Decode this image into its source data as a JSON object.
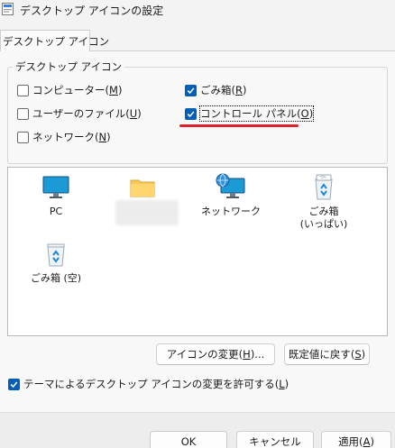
{
  "window": {
    "title": "デスクトップ アイコンの設定"
  },
  "tabs": [
    {
      "label": "デスクトップ アイコン"
    }
  ],
  "group": {
    "legend": "デスクトップ アイコン",
    "checkboxes": [
      {
        "label": "コンピューター(",
        "key": "M",
        "tail": ")",
        "checked": false
      },
      {
        "label": "ユーザーのファイル(",
        "key": "U",
        "tail": ")",
        "checked": false
      },
      {
        "label": "ネットワーク(",
        "key": "N",
        "tail": ")",
        "checked": false
      },
      {
        "label": "ごみ箱(",
        "key": "R",
        "tail": ")",
        "checked": true
      },
      {
        "label": "コントロール パネル(",
        "key": "O",
        "tail": ")",
        "checked": true
      }
    ]
  },
  "icons": [
    {
      "label": "PC",
      "icon": "monitor-icon"
    },
    {
      "label": "",
      "icon": "folder-icon"
    },
    {
      "label": "ネットワーク",
      "icon": "network-icon"
    },
    {
      "label": "ごみ箱",
      "label2": "(いっぱい)",
      "icon": "recycle-bin-full-icon"
    },
    {
      "label": "ごみ箱 (空)",
      "icon": "recycle-bin-empty-icon"
    }
  ],
  "buttons": {
    "change_icon": {
      "label": "アイコンの変更(",
      "key": "H",
      "tail": ")..."
    },
    "restore_default": {
      "label": "既定値に戻す(",
      "key": "S",
      "tail": ")"
    }
  },
  "theme_option": {
    "label": "テーマによるデスクトップ アイコンの変更を許可する(",
    "key": "L",
    "tail": ")",
    "checked": true
  },
  "footer": {
    "ok": "OK",
    "cancel": "キャンセル",
    "apply": {
      "label": "適用(",
      "key": "A",
      "tail": ")"
    }
  },
  "colors": {
    "accent": "#005fb8",
    "annotation": "#e0202a"
  }
}
